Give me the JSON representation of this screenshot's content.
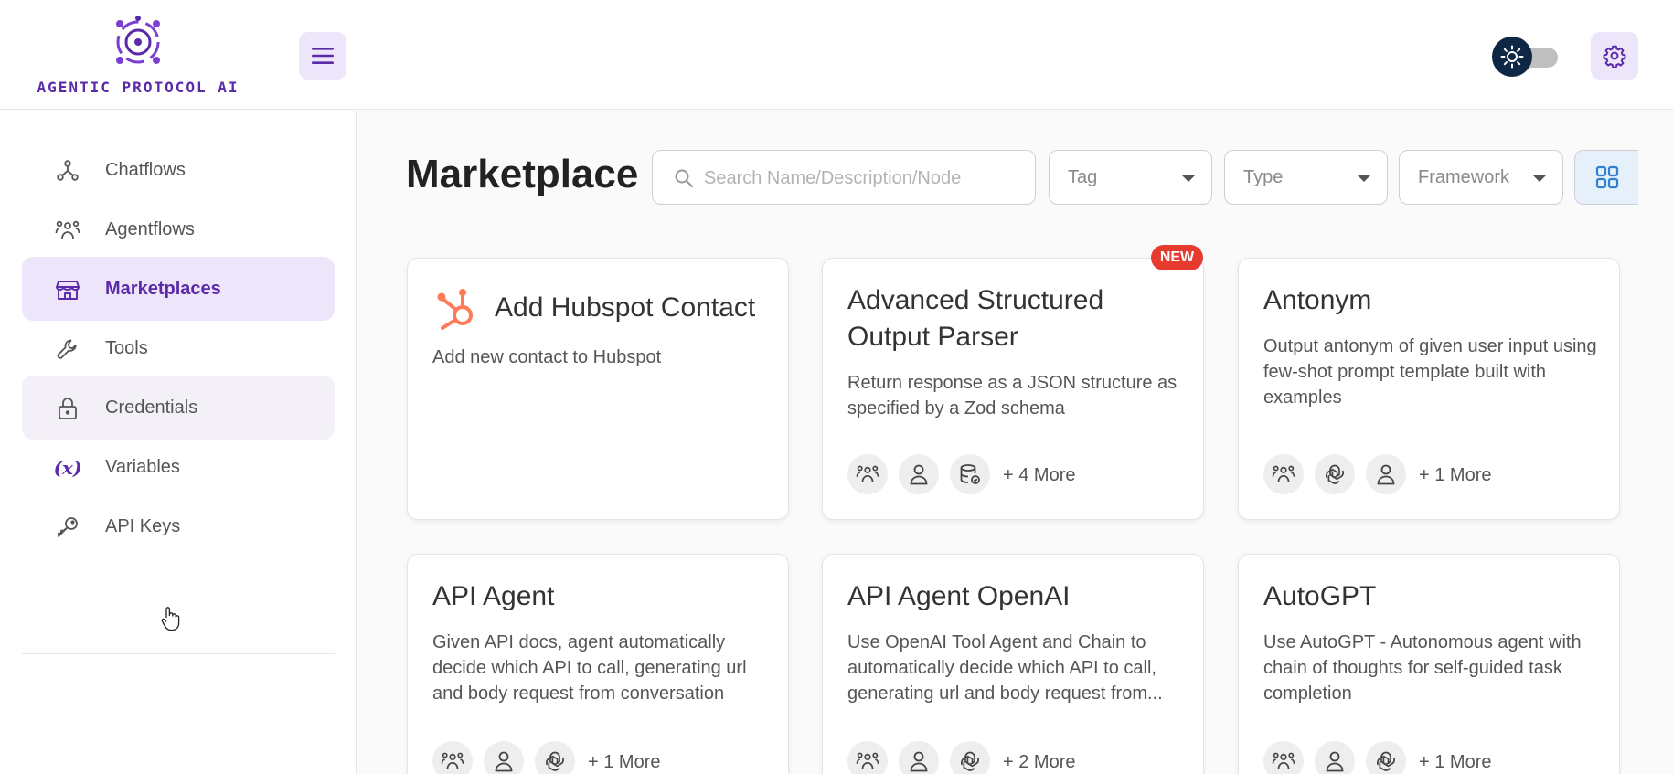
{
  "header": {
    "logo_text": "AGENTIC PROTOCOL AI"
  },
  "sidebar": {
    "items": [
      {
        "label": "Chatflows",
        "icon": "chatflows-icon"
      },
      {
        "label": "Agentflows",
        "icon": "agentflows-icon"
      },
      {
        "label": "Marketplaces",
        "icon": "marketplace-icon",
        "active": true
      },
      {
        "label": "Tools",
        "icon": "wrench-icon"
      },
      {
        "label": "Credentials",
        "icon": "lock-icon",
        "hover": true
      },
      {
        "label": "Variables",
        "icon": "variables-icon",
        "icon_text": "(x)"
      },
      {
        "label": "API Keys",
        "icon": "key-icon"
      }
    ]
  },
  "main": {
    "title": "Marketplace",
    "search_placeholder": "Search Name/Description/Node",
    "filters": {
      "tag": "Tag",
      "type": "Type",
      "framework": "Framework"
    }
  },
  "cards": [
    {
      "title": "Add Hubspot Contact",
      "description": "Add new contact to Hubspot",
      "more": ""
    },
    {
      "title": "Advanced Structured Output Parser",
      "description": "Return response as a JSON structure as specified by a Zod schema",
      "badge": "NEW",
      "more": "+ 4 More"
    },
    {
      "title": "Antonym",
      "description": "Output antonym of given user input using few-shot prompt template built with examples",
      "more": "+ 1 More"
    },
    {
      "title": "API Agent",
      "description": "Given API docs, agent automatically decide which API to call, generating url and body request from conversation",
      "more": "+ 1 More"
    },
    {
      "title": "API Agent OpenAI",
      "description": "Use OpenAI Tool Agent and Chain to automatically decide which API to call, generating url and body request from...",
      "more": "+ 2 More"
    },
    {
      "title": "AutoGPT",
      "description": "Use AutoGPT - Autonomous agent with chain of thoughts for self-guided task completion",
      "more": "+ 1 More"
    }
  ],
  "colors": {
    "accent": "#5a2aa8",
    "accent_bg": "#ede6fb",
    "badge": "#e63b2e",
    "hubspot": "#ff7a59",
    "toggle_knob": "#0e2745",
    "view_toggle": "#2f80d1"
  }
}
